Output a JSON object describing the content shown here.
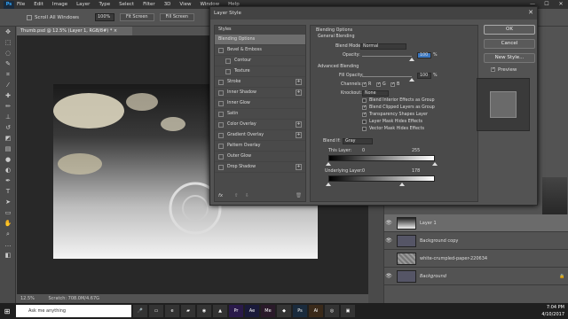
{
  "menubar": {
    "logo": "Ps",
    "items": [
      "File",
      "Edit",
      "Image",
      "Layer",
      "Type",
      "Select",
      "Filter",
      "3D",
      "View",
      "Window",
      "Help"
    ],
    "controls": [
      "—",
      "☐",
      "✕"
    ]
  },
  "options": {
    "scroll_all_windows": "Scroll All Windows",
    "zoom": "100%",
    "fit_screen": "Fit Screen",
    "fill_screen": "Fill Screen"
  },
  "doc_tab": "Thumb.psd @ 12.5% (Layer 1, RGB/8#) * ×",
  "status": {
    "zoom": "12.5%",
    "scratch": "Scratch: 708.0M/4.67G"
  },
  "dialog": {
    "title": "Layer Style",
    "close": "✕",
    "styles_header": "Styles",
    "styles": [
      {
        "label": "Blending Options",
        "checkbox": false,
        "plus": false,
        "selected": true,
        "indent": false
      },
      {
        "label": "Bevel & Emboss",
        "checkbox": true,
        "plus": false,
        "selected": false,
        "indent": false
      },
      {
        "label": "Contour",
        "checkbox": true,
        "plus": false,
        "selected": false,
        "indent": true
      },
      {
        "label": "Texture",
        "checkbox": true,
        "plus": false,
        "selected": false,
        "indent": true
      },
      {
        "label": "Stroke",
        "checkbox": true,
        "plus": true,
        "selected": false,
        "indent": false
      },
      {
        "label": "Inner Shadow",
        "checkbox": true,
        "plus": true,
        "selected": false,
        "indent": false
      },
      {
        "label": "Inner Glow",
        "checkbox": true,
        "plus": false,
        "selected": false,
        "indent": false
      },
      {
        "label": "Satin",
        "checkbox": true,
        "plus": false,
        "selected": false,
        "indent": false
      },
      {
        "label": "Color Overlay",
        "checkbox": true,
        "plus": true,
        "selected": false,
        "indent": false
      },
      {
        "label": "Gradient Overlay",
        "checkbox": true,
        "plus": true,
        "selected": false,
        "indent": false
      },
      {
        "label": "Pattern Overlay",
        "checkbox": true,
        "plus": false,
        "selected": false,
        "indent": false
      },
      {
        "label": "Outer Glow",
        "checkbox": true,
        "plus": false,
        "selected": false,
        "indent": false
      },
      {
        "label": "Drop Shadow",
        "checkbox": true,
        "plus": true,
        "selected": false,
        "indent": false
      }
    ],
    "fx": "fx",
    "blending": {
      "section": "Blending Options",
      "general": "General Blending",
      "blend_mode_label": "Blend Mode:",
      "blend_mode": "Normal",
      "opacity_label": "Opacity:",
      "opacity": "100",
      "pct": "%",
      "advanced": "Advanced Blending",
      "fill_opacity_label": "Fill Opacity:",
      "fill_opacity": "100",
      "channels_label": "Channels:",
      "channel_r": "R",
      "channel_g": "G",
      "channel_b": "B",
      "knockout_label": "Knockout:",
      "knockout": "None",
      "options": [
        {
          "label": "Blend Interior Effects as Group",
          "checked": false
        },
        {
          "label": "Blend Clipped Layers as Group",
          "checked": true
        },
        {
          "label": "Transparency Shapes Layer",
          "checked": true
        },
        {
          "label": "Layer Mask Hides Effects",
          "checked": false
        },
        {
          "label": "Vector Mask Hides Effects",
          "checked": false
        }
      ],
      "blend_if_label": "Blend If:",
      "blend_if": "Gray",
      "this_layer_label": "This Layer:",
      "this_layer_min": "0",
      "this_layer_max": "255",
      "underlying_label": "Underlying Layer:",
      "underlying_min": "0",
      "underlying_max": "178",
      "opacity_fraction": 1.0,
      "fill_fraction": 1.0
    },
    "buttons": {
      "ok": "OK",
      "cancel": "Cancel",
      "new_style": "New Style...",
      "preview": "Preview"
    }
  },
  "layers": [
    {
      "name": "Layer 1",
      "selected": true,
      "lock": ""
    },
    {
      "name": "Background copy",
      "selected": false,
      "lock": ""
    },
    {
      "name": "white-crumpled-paper-220634",
      "selected": false,
      "lock": ""
    },
    {
      "name": "Background",
      "selected": false,
      "lock": "🔒"
    }
  ],
  "taskbar": {
    "search_placeholder": "Ask me anything",
    "time": "7:04 PM",
    "date": "4/10/2017"
  },
  "colors": {
    "accent": "#31a8ff",
    "dialog_bg": "#535353",
    "panel_bg": "#4a4a4a"
  }
}
